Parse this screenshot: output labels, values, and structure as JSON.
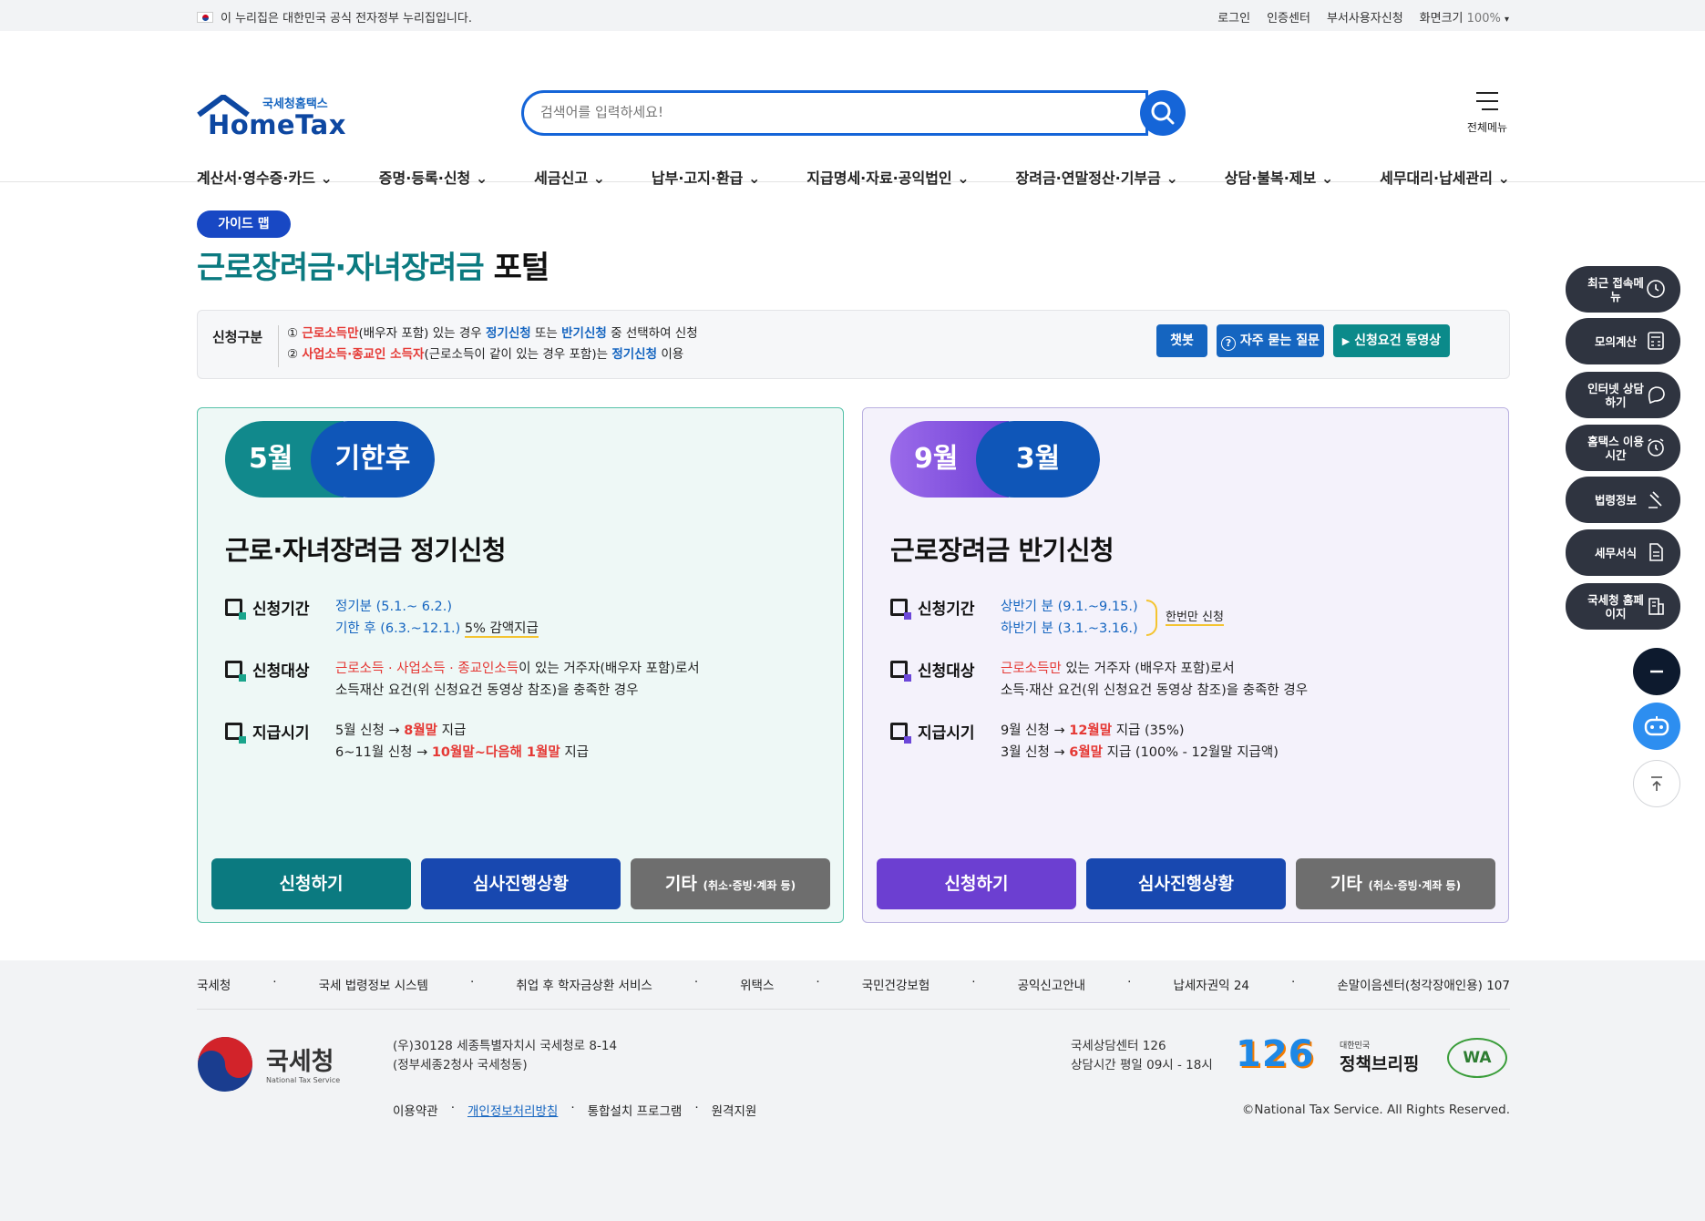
{
  "topbar": {
    "gov_notice": "이 누리집은 대한민국 공식 전자정부 누리집입니다.",
    "links": [
      "로그인",
      "인증센터",
      "부서사용자신청"
    ],
    "zoom_label": "화면크기",
    "zoom_value": "100%"
  },
  "header": {
    "logo_small": "국세청홈택스",
    "logo_big": "HomeTax",
    "search_placeholder": "검색어를 입력하세요!",
    "allmenu_label": "전체메뉴"
  },
  "nav": [
    "계산서·영수증·카드",
    "증명·등록·신청",
    "세금신고",
    "납부·고지·환급",
    "지급명세·자료·공익법인",
    "장려금·연말정산·기부금",
    "상담·불복·제보",
    "세무대리·납세관리"
  ],
  "page": {
    "badge": "가이드 맵",
    "title_highlight": "근로장려금·자녀장려금",
    "title_rest": "포털"
  },
  "info": {
    "label": "신청구분",
    "line1": {
      "num": "①",
      "red": "근로소득만",
      "t1": "(배우자 포함) 있는 경우",
      "b1": "정기신청",
      "t2": "또는",
      "b2": "반기신청",
      "t3": "중 선택하여 신청"
    },
    "line2": {
      "num": "②",
      "red": "사업소득·종교인 소득자",
      "t1": "(근로소득이 같이 있는 경우 포함)는",
      "b1": "정기신청",
      "t2": "이용"
    },
    "buttons": [
      "챗봇",
      "자주 묻는 질문",
      "신청요건 동영상"
    ]
  },
  "cards": [
    {
      "pill_a": "5월",
      "pill_b": "기한후",
      "title": "근로·자녀장려금 정기신청",
      "period_label": "신청기간",
      "period1": "정기분 (5.1.~ 6.2.)",
      "period2": "기한 후 (6.3.~12.1.)",
      "period2_note": "5% 감액지급",
      "target_label": "신청대상",
      "target_red": "근로소득 · 사업소득 · 종교인소득",
      "target_t1": "이 있는 거주자(배우자 포함)로서",
      "target_t2": "소득재산 요건(위 신청요건 동영상 참조)을 충족한 경우",
      "pay_label": "지급시기",
      "pay1_pre": "5월 신청",
      "pay1_red": "8월말",
      "pay1_post": "지급",
      "pay2_pre": "6~11월 신청",
      "pay2_red": "10월말~다음해 1월말",
      "pay2_post": "지급",
      "btn_apply": "신청하기",
      "btn_status": "심사진행상황",
      "btn_etc": "기타",
      "btn_etc_small": "(취소·증빙·계좌 등)"
    },
    {
      "pill_a": "9월",
      "pill_b": "3월",
      "title": "근로장려금 반기신청",
      "period_label": "신청기간",
      "period1": "상반기 분 (9.1.~9.15.)",
      "period2": "하반기 분 (3.1.~3.16.)",
      "period_note": "한번만 신청",
      "target_label": "신청대상",
      "target_red": "근로소득만",
      "target_t1": "있는 거주자 (배우자 포함)로서",
      "target_t2": "소득·재산 요건(위 신청요건 동영상 참조)을 충족한 경우",
      "pay_label": "지급시기",
      "pay1_pre": "9월 신청",
      "pay1_red": "12월말",
      "pay1_post": "지급 (35%)",
      "pay2_pre": "3월 신청",
      "pay2_red": "6월말",
      "pay2_post": "지급 (100% - 12월말 지급액)",
      "btn_apply": "신청하기",
      "btn_status": "심사진행상황",
      "btn_etc": "기타",
      "btn_etc_small": "(취소·증빙·계좌 등)"
    }
  ],
  "sidebar": [
    "최근 접속메뉴",
    "모의계산",
    "인터넷 상담하기",
    "홈택스 이용시간",
    "법령정보",
    "세무서식",
    "국세청 홈페이지"
  ],
  "footer": {
    "links": [
      "국세청",
      "국세 법령정보 시스템",
      "취업 후 학자금상환 서비스",
      "위택스",
      "국민건강보험",
      "공익신고안내",
      "납세자권익 24",
      "손말이음센터(청각장애인용) 107"
    ],
    "org_ko": "국세청",
    "org_en": "National Tax Service",
    "addr1": "(우)30128 세종특별자치시 국세청로 8-14",
    "addr2": "(정부세종2청사 국세청동)",
    "bottom_links": [
      "이용약관",
      "개인정보처리방침",
      "통합설치 프로그램",
      "원격지원"
    ],
    "call1": "국세상담센터 126",
    "call2": "상담시간 평일 09시 - 18시",
    "logo126": "126",
    "brief_small": "대한민국",
    "brief_big": "정책브리핑",
    "wa": "WA",
    "copyright": "©National Tax Service. All Rights Reserved."
  },
  "colors": {
    "teal": "#0b7a80",
    "blue": "#1848c4",
    "purple": "#6c3fd1",
    "gray": "#6e6e6e",
    "red": "#e53935"
  }
}
